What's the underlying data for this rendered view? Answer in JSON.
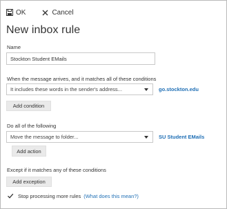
{
  "toolbar": {
    "ok_label": "OK",
    "cancel_label": "Cancel"
  },
  "page": {
    "title": "New inbox rule"
  },
  "name_section": {
    "label": "Name",
    "value": "Stockton Student EMails"
  },
  "conditions": {
    "label": "When the message arrives, and it matches all of these conditions",
    "selected": "It includes these words in the sender's address...",
    "value_link": "go.stockton.edu",
    "add_button": "Add condition"
  },
  "actions": {
    "label": "Do all of the following",
    "selected": "Move the message to folder...",
    "value_link": "SU Student EMails",
    "add_button": "Add action"
  },
  "exceptions": {
    "label": "Except if it matches any of these conditions",
    "add_button": "Add exception"
  },
  "stop_processing": {
    "label": "Stop processing more rules",
    "checked": true,
    "help_link": "(What does this mean?)"
  },
  "colors": {
    "accent": "#1f6fb5",
    "button_bg": "#eaeaea",
    "border": "#c8c8c8"
  },
  "icons": {
    "ok": "save-icon",
    "cancel": "close-icon",
    "dropdown": "chevron-down-icon",
    "check": "check-icon"
  }
}
